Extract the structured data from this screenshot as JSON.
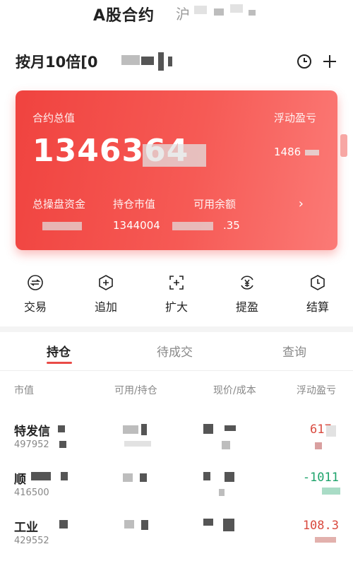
{
  "header": {
    "title": "A股合约",
    "subtitle": "沪"
  },
  "account": {
    "name": "按月10倍[0"
  },
  "card": {
    "total_label": "合约总值",
    "total_value": "1346364",
    "float_label": "浮动盈亏",
    "float_value": "1486",
    "margin_label": "总操盘资金",
    "margin_value": "",
    "holding_label": "持仓市值",
    "holding_value": "1344004",
    "available_label": "可用余额",
    "available_value": ".35"
  },
  "actions": [
    {
      "label": "交易",
      "icon": "exchange-icon"
    },
    {
      "label": "追加",
      "icon": "plus-hexagon-icon"
    },
    {
      "label": "扩大",
      "icon": "expand-icon"
    },
    {
      "label": "提盈",
      "icon": "yen-withdraw-icon"
    },
    {
      "label": "结算",
      "icon": "clock-settle-icon"
    }
  ],
  "tabs": [
    "持仓",
    "待成交",
    "查询"
  ],
  "columns": [
    "市值",
    "可用/持仓",
    "现价/成本",
    "浮动盈亏"
  ],
  "rows": [
    {
      "name": "特发信",
      "value": "497952",
      "pnl": "617.",
      "direction": "up"
    },
    {
      "name": "顺",
      "value": "416500",
      "pnl": "-1011",
      "direction": "down"
    },
    {
      "name": "工业",
      "value": "429552",
      "pnl": "108.3",
      "direction": "up"
    }
  ],
  "colors": {
    "accent": "#f0433f",
    "up": "#d94a3f",
    "down": "#1da36b"
  }
}
